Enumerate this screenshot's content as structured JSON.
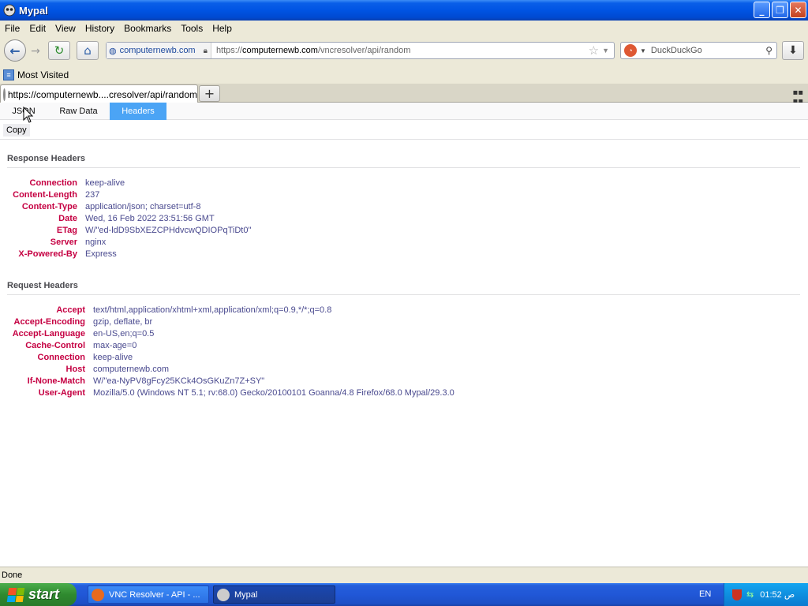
{
  "window": {
    "title": "Mypal"
  },
  "menu": [
    "File",
    "Edit",
    "View",
    "History",
    "Bookmarks",
    "Tools",
    "Help"
  ],
  "nav": {
    "identity_site": "computernewb.com",
    "url_prefix": "https://",
    "url_host": "computernewb.com",
    "url_path": "/vncresolver/api/random",
    "search_placeholder": "DuckDuckGo"
  },
  "bookmarks": {
    "most_visited": "Most Visited"
  },
  "tab": {
    "title": "https://computernewb....cresolver/api/random"
  },
  "viewer": {
    "tabs": {
      "json": "JSON",
      "raw": "Raw Data",
      "headers": "Headers"
    },
    "copy": "Copy"
  },
  "response": {
    "title": "Response Headers",
    "rows": [
      {
        "name": "Connection",
        "value": "keep-alive"
      },
      {
        "name": "Content-Length",
        "value": "237"
      },
      {
        "name": "Content-Type",
        "value": "application/json; charset=utf-8"
      },
      {
        "name": "Date",
        "value": "Wed, 16 Feb 2022 23:51:56 GMT"
      },
      {
        "name": "ETag",
        "value": "W/\"ed-ldD9SbXEZCPHdvcwQDIOPqTiDt0\""
      },
      {
        "name": "Server",
        "value": "nginx"
      },
      {
        "name": "X-Powered-By",
        "value": "Express"
      }
    ]
  },
  "request": {
    "title": "Request Headers",
    "rows": [
      {
        "name": "Accept",
        "value": "text/html,application/xhtml+xml,application/xml;q=0.9,*/*;q=0.8"
      },
      {
        "name": "Accept-Encoding",
        "value": "gzip, deflate, br"
      },
      {
        "name": "Accept-Language",
        "value": "en-US,en;q=0.5"
      },
      {
        "name": "Cache-Control",
        "value": "max-age=0"
      },
      {
        "name": "Connection",
        "value": "keep-alive"
      },
      {
        "name": "Host",
        "value": "computernewb.com"
      },
      {
        "name": "If-None-Match",
        "value": "W/\"ea-NyPV8gFcy25KCk4OsGKuZn7Z+SY\""
      },
      {
        "name": "User-Agent",
        "value": "Mozilla/5.0 (Windows NT 5.1; rv:68.0) Gecko/20100101 Goanna/4.8 Firefox/68.0 Mypal/29.3.0"
      }
    ]
  },
  "status": {
    "text": "Done"
  },
  "taskbar": {
    "start": "start",
    "items": [
      "VNC Resolver - API - ...",
      "Mypal"
    ],
    "lang": "EN",
    "clock": "01:52 ص"
  },
  "colors": {
    "accent": "#4ba4f5",
    "header_name": "#c50042",
    "header_value": "#4a4a8f"
  }
}
